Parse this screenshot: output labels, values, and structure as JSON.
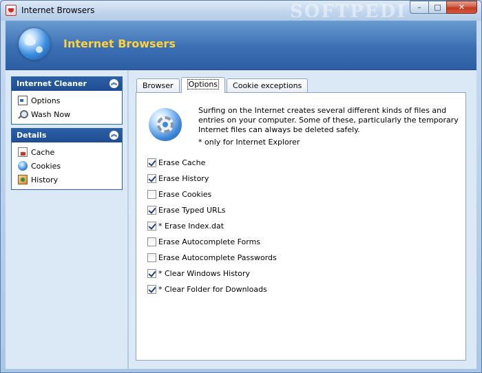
{
  "window": {
    "title": "Internet Browsers",
    "watermark": "SOFTPEDI",
    "buttons": {
      "minimize": "–",
      "maximize": "□",
      "close": "✕"
    }
  },
  "header": {
    "title": "Internet Browsers"
  },
  "sidebar": {
    "panels": [
      {
        "title": "Internet Cleaner",
        "collapse": "︽",
        "items": [
          {
            "label": "Options",
            "icon": "options-icon"
          },
          {
            "label": "Wash Now",
            "icon": "magnifier-icon"
          }
        ]
      },
      {
        "title": "Details",
        "collapse": "︽",
        "items": [
          {
            "label": "Cache",
            "icon": "cache-icon"
          },
          {
            "label": "Cookies",
            "icon": "cookies-icon"
          },
          {
            "label": "History",
            "icon": "history-icon"
          }
        ]
      }
    ]
  },
  "tabs": [
    {
      "label": "Browser",
      "active": false
    },
    {
      "label": "Options",
      "active": true
    },
    {
      "label": "Cookie exceptions",
      "active": false
    }
  ],
  "options_page": {
    "description": "Surfing on the Internet creates several different kinds of files and entries on your computer. Some of these, particularly the temporary Internet files can always be deleted safely.",
    "note": "*  only for Internet Explorer",
    "options": [
      {
        "label": "Erase Cache",
        "checked": true
      },
      {
        "label": "Erase History",
        "checked": true
      },
      {
        "label": "Erase Cookies",
        "checked": false
      },
      {
        "label": "Erase Typed URLs",
        "checked": true
      },
      {
        "label": "* Erase Index.dat",
        "checked": true
      },
      {
        "label": "Erase Autocomplete Forms",
        "checked": false
      },
      {
        "label": "Erase Autocomplete Passwords",
        "checked": false
      },
      {
        "label": "* Clear Windows History",
        "checked": true
      },
      {
        "label": "* Clear Folder for Downloads",
        "checked": true
      }
    ]
  },
  "colors": {
    "header_blue": "#3b6fb3",
    "header_title": "#ffd23a",
    "panel_head": "#1e4d91"
  }
}
